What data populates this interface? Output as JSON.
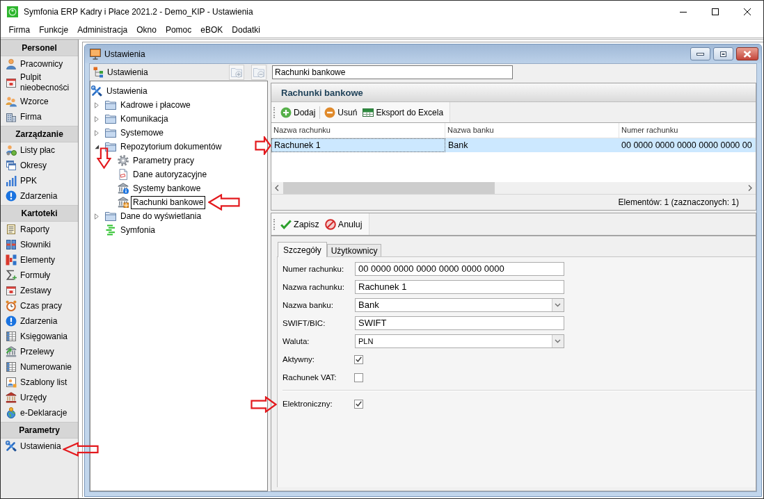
{
  "window": {
    "title": "Symfonia ERP Kadry i Płace 2021.2 - Demo_KIP - Ustawienia"
  },
  "menu": [
    {
      "label": "Firma"
    },
    {
      "label": "Funkcje"
    },
    {
      "label": "Administracja"
    },
    {
      "label": "Okno"
    },
    {
      "label": "Pomoc"
    },
    {
      "label": "eBOK"
    },
    {
      "label": "Dodatki"
    }
  ],
  "sidebar": {
    "sections": [
      {
        "title": "Personel",
        "items": [
          {
            "label": "Pracownicy"
          },
          {
            "label": "Pulpit nieobecności"
          },
          {
            "label": "Wzorce"
          },
          {
            "label": "Firma"
          }
        ]
      },
      {
        "title": "Zarządzanie",
        "items": [
          {
            "label": "Listy płac"
          },
          {
            "label": "Okresy"
          },
          {
            "label": "PPK"
          },
          {
            "label": "Zdarzenia"
          }
        ]
      },
      {
        "title": "Kartoteki",
        "items": [
          {
            "label": "Raporty"
          },
          {
            "label": "Słowniki"
          },
          {
            "label": "Elementy"
          },
          {
            "label": "Formuły"
          },
          {
            "label": "Zestawy"
          },
          {
            "label": "Czas pracy"
          },
          {
            "label": "Zdarzenia"
          },
          {
            "label": "Księgowania"
          },
          {
            "label": "Przelewy"
          },
          {
            "label": "Numerowanie"
          },
          {
            "label": "Szablony list"
          },
          {
            "label": "Urzędy"
          },
          {
            "label": "e-Deklaracje"
          }
        ]
      },
      {
        "title": "Parametry",
        "items": [
          {
            "label": "Ustawienia",
            "pointer_arrow": true
          }
        ]
      }
    ]
  },
  "child_window": {
    "title": "Ustawienia"
  },
  "tree_panel": {
    "title": "Ustawienia",
    "buttons": [
      {
        "disabled": true
      },
      {
        "disabled": true
      }
    ],
    "tree": [
      {
        "label": "Ustawienia",
        "selected": false,
        "children": [
          {
            "label": "Kadrowe i płacowe",
            "expanded": false,
            "selected": false
          },
          {
            "label": "Komunikacja",
            "expanded": false,
            "selected": false
          },
          {
            "label": "Systemowe",
            "expanded": false,
            "selected": false
          },
          {
            "label": "Repozytorium dokumentów",
            "expanded": true,
            "selected": false,
            "pointer_arrow": true,
            "children": [
              {
                "label": "Parametry pracy",
                "selected": false
              },
              {
                "label": "Dane autoryzacyjne",
                "selected": false
              },
              {
                "label": "Systemy bankowe",
                "selected": false
              },
              {
                "label": "Rachunki bankowe",
                "selected": true,
                "pointer_arrow": true
              }
            ]
          },
          {
            "label": "Dane do wyświetlania",
            "expanded": false,
            "selected": false
          },
          {
            "label": "Symfonia",
            "selected": false
          }
        ]
      }
    ]
  },
  "path_field": {
    "value": "Rachunki bankowe"
  },
  "accounts_panel": {
    "title": "Rachunki bankowe",
    "toolbar": [
      {
        "label": "Dodaj"
      },
      {
        "label": "Usuń"
      },
      {
        "label": "Eksport do Excela"
      }
    ],
    "table": {
      "columns": [
        "Nazwa rachunku",
        "Nazwa banku",
        "Numer rachunku"
      ],
      "rows": [
        {
          "cells": [
            "Rachunek 1",
            "Bank",
            "00 0000 0000 0000 0000 0000 00"
          ],
          "selected": true,
          "pointer_arrow": true
        }
      ]
    },
    "status": "Elementów: 1 (zaznaczonych: 1)"
  },
  "details_panel": {
    "toolbar": [
      {
        "label": "Zapisz"
      },
      {
        "label": "Anuluj"
      }
    ],
    "tabs": [
      {
        "label": "Szczegóły",
        "selected": true
      },
      {
        "label": "Użytkownicy",
        "selected": false
      }
    ],
    "field_groups": [
      [
        {
          "kind": "text",
          "label": "Numer rachunku:",
          "value": "00 0000 0000 0000 0000 0000 0000"
        },
        {
          "kind": "text",
          "label": "Nazwa rachunku:",
          "value": "Rachunek 1"
        },
        {
          "kind": "combo",
          "label": "Nazwa banku:",
          "value": "Bank"
        },
        {
          "kind": "text",
          "label": "SWIFT/BIC:",
          "value": "SWIFT"
        },
        {
          "kind": "dropdown",
          "label": "Waluta:",
          "value": "PLN"
        },
        {
          "kind": "checkbox",
          "label": "Aktywny:",
          "checked": true
        },
        {
          "kind": "checkbox",
          "label": "Rachunek VAT:",
          "checked": false
        }
      ],
      [
        {
          "kind": "checkbox",
          "label": "Elektroniczny:",
          "checked": true,
          "pointer_arrow": true
        }
      ]
    ]
  }
}
